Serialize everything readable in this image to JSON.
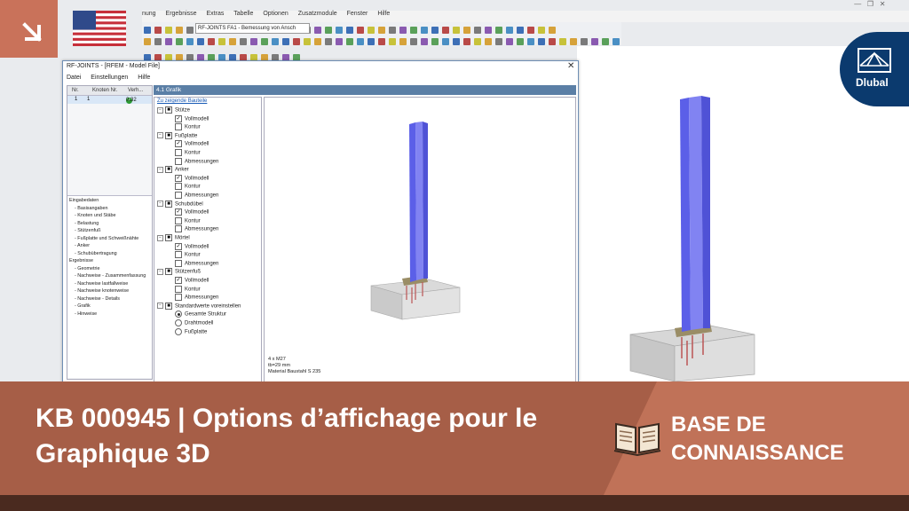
{
  "main_menu": [
    "nung",
    "Ergebnisse",
    "Extras",
    "Tabelle",
    "Optionen",
    "Zusatzmodule",
    "Fenster",
    "Hilfe"
  ],
  "module_select": "RF-JOINTS FA1 - Bemessung von Ansch",
  "dialog": {
    "title": "RF-JOINTS - [RFEM - Model File]",
    "close": "✕",
    "menu": [
      "Datei",
      "Einstellungen",
      "Hilfe"
    ],
    "result_headers": [
      "Nr.",
      "Knoten Nr.",
      "Verh..."
    ],
    "result_row": {
      "nr": "1",
      "knoten": "1",
      "ratio": "0.32"
    },
    "nav": [
      "Eingabedaten",
      "- Basisangaben",
      "- Knoten und Stäbe",
      "- Belastung",
      "- Stützenfuß",
      "- Fußplatte und Schweißnähte",
      "- Anker",
      "- Schubübertragung",
      "Ergebnisse",
      "- Geometrie",
      "- Nachweise - Zusammenfassung",
      "- Nachweise lastfallweise",
      "- Nachweise knotenweise",
      "- Nachweise - Details",
      "- Grafik",
      "- Hinweise"
    ],
    "section_header": "4.1 Grafik",
    "tree_title": "Zu zeigende Bauteile",
    "tree": [
      {
        "label": "Stütze",
        "items": [
          {
            "label": "Vollmodell",
            "checked": true
          },
          {
            "label": "Kontur",
            "checked": false
          }
        ]
      },
      {
        "label": "Fußplatte",
        "items": [
          {
            "label": "Vollmodell",
            "checked": true
          },
          {
            "label": "Kontur",
            "checked": false
          },
          {
            "label": "Abmessungen",
            "checked": false
          }
        ]
      },
      {
        "label": "Anker",
        "items": [
          {
            "label": "Vollmodell",
            "checked": true
          },
          {
            "label": "Kontur",
            "checked": false
          },
          {
            "label": "Abmessungen",
            "checked": false
          }
        ]
      },
      {
        "label": "Schubdübel",
        "items": [
          {
            "label": "Vollmodell",
            "checked": true
          },
          {
            "label": "Kontur",
            "checked": false
          },
          {
            "label": "Abmessungen",
            "checked": false
          }
        ]
      },
      {
        "label": "Mörtel",
        "items": [
          {
            "label": "Vollmodell",
            "checked": true
          },
          {
            "label": "Kontur",
            "checked": false
          },
          {
            "label": "Abmessungen",
            "checked": false
          }
        ]
      },
      {
        "label": "Stützenfuß",
        "items": [
          {
            "label": "Vollmodell",
            "checked": true
          },
          {
            "label": "Kontur",
            "checked": false
          },
          {
            "label": "Abmessungen",
            "checked": false
          }
        ]
      }
    ],
    "defaults_label": "Standardwerte voreinstellen",
    "radios": [
      {
        "label": "Gesamte Struktur",
        "selected": true
      },
      {
        "label": "Drahtmodell",
        "selected": false
      },
      {
        "label": "Fußplatte",
        "selected": false
      }
    ],
    "graphic_info": [
      "4 x M27",
      "tb=29 mm",
      "Material Baustahl S 235"
    ]
  },
  "logo_text": "Dlubal",
  "banner": {
    "title": "KB 000945 | Options d’affichage pour le Graphique 3D",
    "label": "BASE DE CONNAISSANCE"
  },
  "colors": {
    "banner": "#a65e47",
    "banner_accent": "#c07258",
    "column": "#6b6ef0",
    "logo": "#0b3a6e"
  }
}
